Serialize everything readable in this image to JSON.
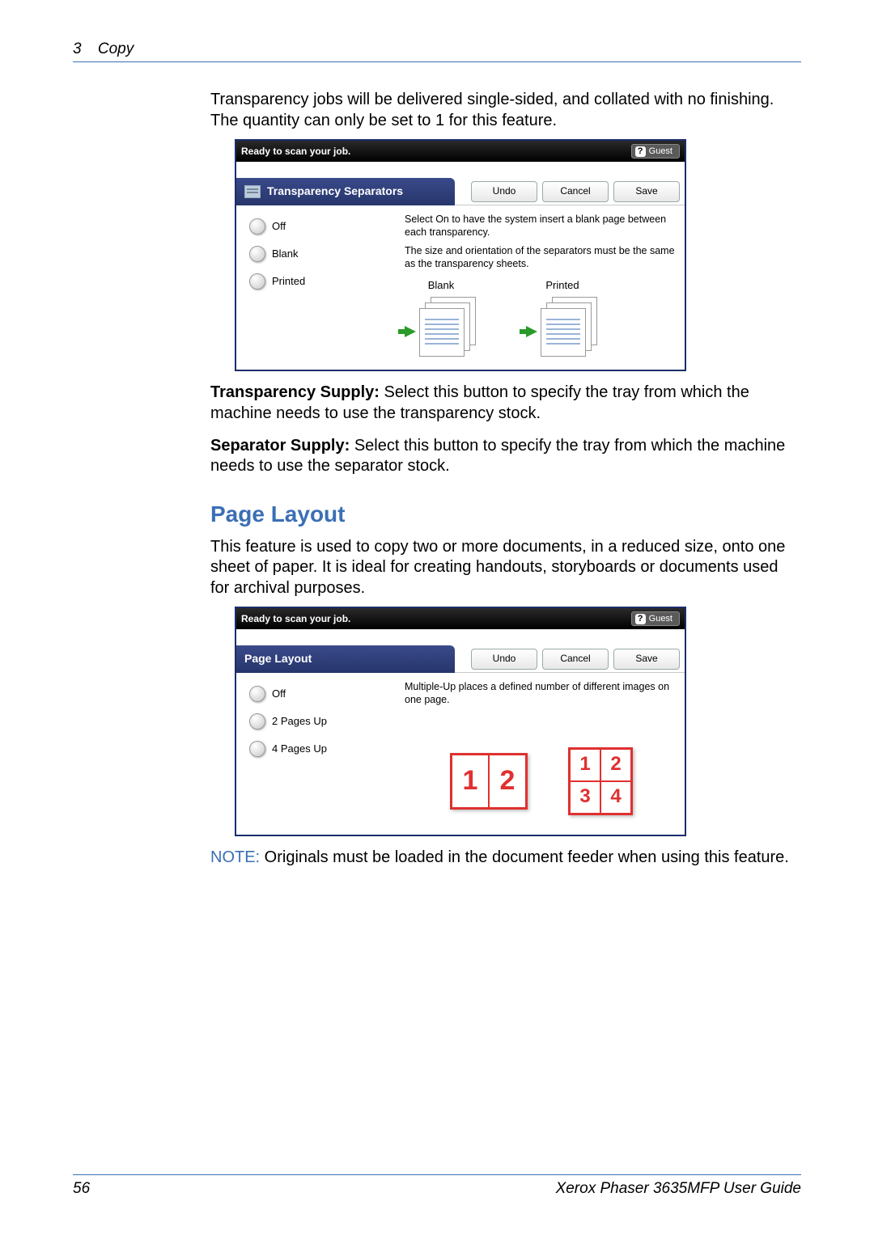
{
  "header": {
    "section": "3",
    "title": "Copy"
  },
  "intro": "Transparency jobs will be delivered single-sided, and collated with no finishing. The quantity can only be set to 1 for this feature.",
  "screenshot1": {
    "status": "Ready to scan your job.",
    "guest": "Guest",
    "title": "Transparency Separators",
    "buttons": {
      "undo": "Undo",
      "cancel": "Cancel",
      "save": "Save"
    },
    "options": {
      "off": "Off",
      "blank": "Blank",
      "printed": "Printed"
    },
    "desc1": "Select On to have the system insert a blank page between each transparency.",
    "desc2": "The size and orientation of the separators must be the same as the transparency sheets.",
    "illus": {
      "blank": "Blank",
      "printed": "Printed"
    }
  },
  "transparency_supply": {
    "label": "Transparency Supply:",
    "text": " Select this button to specify the tray from which the machine needs to use the transparency stock."
  },
  "separator_supply": {
    "label": "Separator Supply:",
    "text": " Select this button to specify the tray from which the machine needs to use the separator stock."
  },
  "section_title": "Page Layout",
  "pl_intro": "This feature is used to copy two or more documents, in a reduced size, onto one sheet of paper. It is ideal for creating handouts, storyboards or documents used for archival purposes.",
  "screenshot2": {
    "status": "Ready to scan your job.",
    "guest": "Guest",
    "title": "Page Layout",
    "buttons": {
      "undo": "Undo",
      "cancel": "Cancel",
      "save": "Save"
    },
    "options": {
      "off": "Off",
      "p2": "2 Pages Up",
      "p4": "4 Pages Up"
    },
    "desc": "Multiple-Up places a defined number of different images on one page.",
    "nums": {
      "n1": "1",
      "n2": "2",
      "n3": "3",
      "n4": "4"
    }
  },
  "note": {
    "label": "NOTE:",
    "text": " Originals must be loaded in the document feeder when using this feature."
  },
  "footer": {
    "page": "56",
    "guide": "Xerox Phaser 3635MFP User Guide"
  }
}
